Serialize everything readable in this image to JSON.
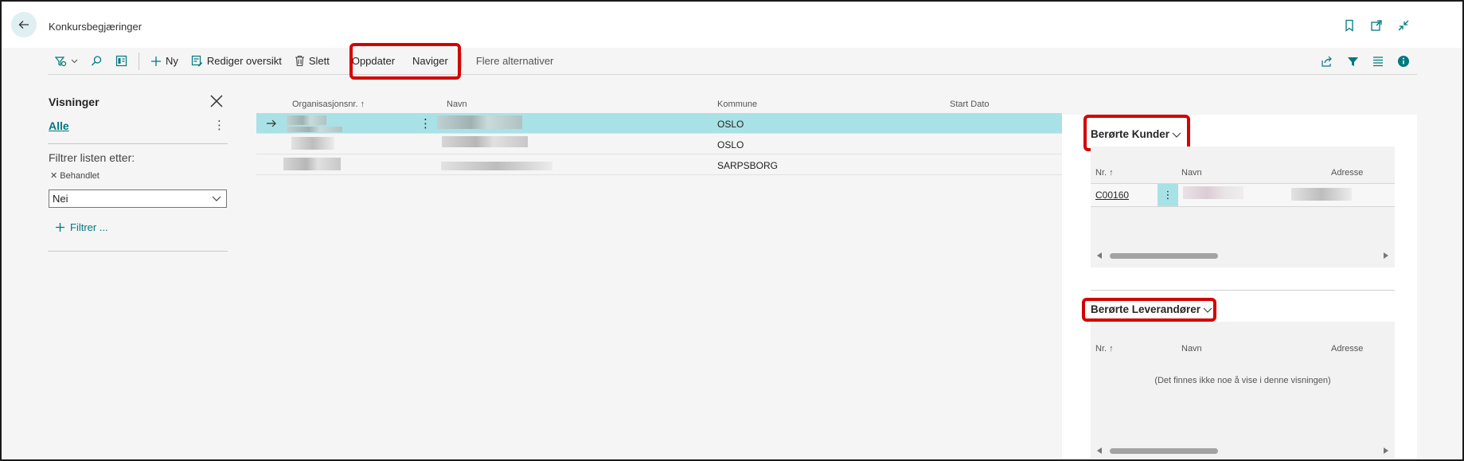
{
  "header": {
    "title": "Konkursbegjæringer"
  },
  "actions": {
    "new": "Ny",
    "edit_list": "Rediger oversikt",
    "delete": "Slett",
    "update": "Oppdater",
    "navigate": "Naviger",
    "more": "Flere alternativer"
  },
  "views": {
    "title": "Visninger",
    "all": "Alle",
    "filter_by": "Filtrer listen etter:",
    "filter_field": "Behandlet",
    "filter_value": "Nei",
    "add_filter": "Filtrer ..."
  },
  "list": {
    "columns": [
      "Organisasjonsnr. ↑",
      "Navn",
      "Kommune",
      "Start Dato"
    ],
    "rows": [
      {
        "kommune": "OSLO"
      },
      {
        "kommune": "OSLO"
      },
      {
        "kommune": "SARPSBORG"
      }
    ]
  },
  "factbox": {
    "customers": {
      "title": "Berørte Kunder",
      "columns": [
        "Nr. ↑",
        "Navn",
        "Adresse"
      ],
      "rows": [
        {
          "no": "C00160"
        }
      ]
    },
    "suppliers": {
      "title": "Berørte Leverandører",
      "columns": [
        "Nr. ↑",
        "Navn",
        "Adresse"
      ],
      "empty": "(Det finnes ikke noe å vise i denne visningen)"
    }
  },
  "colors": {
    "accent": "#00797f",
    "selected_row": "#a9e2e6",
    "highlight": "#d50000"
  }
}
